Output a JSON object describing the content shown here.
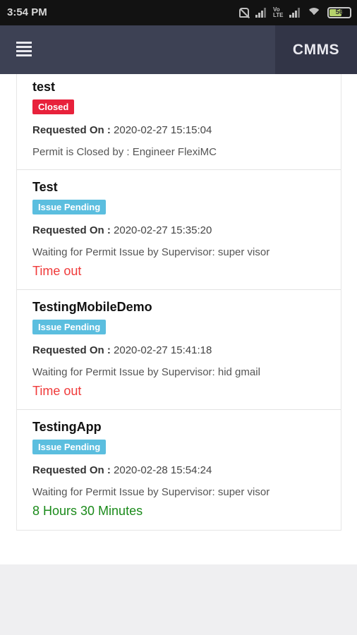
{
  "status_bar": {
    "time": "3:54 PM",
    "battery_level": "56"
  },
  "app_bar": {
    "title": "CMMS"
  },
  "permits": [
    {
      "title": "test",
      "status": "Closed",
      "status_color": "#e8213b",
      "requested_label": "Requested On :",
      "requested_on": "2020-02-27 15:15:04",
      "message": "Permit is Closed by : Engineer FlexiMC",
      "timer": ""
    },
    {
      "title": "Test",
      "status": "Issue Pending",
      "status_color": "#5bbedf",
      "requested_label": "Requested On :",
      "requested_on": "2020-02-27 15:35:20",
      "message": "Waiting for Permit Issue by Supervisor: super visor",
      "timer": "Time out",
      "timer_color": "#f03a3a"
    },
    {
      "title": "TestingMobileDemo",
      "status": "Issue Pending",
      "status_color": "#5bbedf",
      "requested_label": "Requested On :",
      "requested_on": "2020-02-27 15:41:18",
      "message": "Waiting for Permit Issue by Supervisor: hid gmail",
      "timer": "Time out",
      "timer_color": "#f03a3a"
    },
    {
      "title": "TestingApp",
      "status": "Issue Pending",
      "status_color": "#5bbedf",
      "requested_label": "Requested On :",
      "requested_on": "2020-02-28 15:54:24",
      "message": "Waiting for Permit Issue by Supervisor: super visor",
      "timer": "8 Hours 30 Minutes",
      "timer_color": "#1a8a1a"
    }
  ]
}
